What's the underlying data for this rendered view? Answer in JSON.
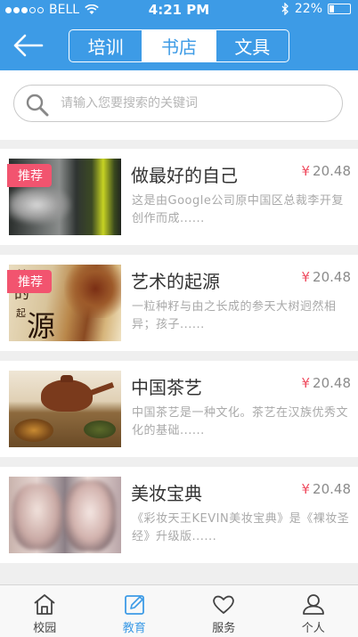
{
  "status": {
    "carrier": "BELL",
    "time": "4:21 PM",
    "battery": "22%",
    "battery_level": 0.22
  },
  "header": {
    "tabs": [
      "培训",
      "书店",
      "文具"
    ],
    "active_tab": 1
  },
  "search": {
    "placeholder": "请输入您要搜索的关键词"
  },
  "books": [
    {
      "title": "做最好的自己",
      "price": "20.48",
      "currency": "¥",
      "badge": "推荐",
      "desc": "这是由Google公司原中国区总裁李开复创作而成......"
    },
    {
      "title": "艺术的起源",
      "price": "20.48",
      "currency": "¥",
      "badge": "推荐",
      "desc": "一粒种籽与由之长成的参天大树迥然相异；孩子......"
    },
    {
      "title": "中国茶艺",
      "price": "20.48",
      "currency": "¥",
      "badge": "",
      "desc": "中国茶艺是一种文化。茶艺在汉族优秀文化的基础......"
    },
    {
      "title": "美妆宝典",
      "price": "20.48",
      "currency": "¥",
      "badge": "",
      "desc": "《彩妆天王KEVIN美妆宝典》是《裸妆圣经》升级版......"
    }
  ],
  "tabbar": [
    "校园",
    "教育",
    "服务",
    "个人"
  ],
  "tabbar_active": 1,
  "colors": {
    "primary": "#3d9be6",
    "badge": "#f2546f",
    "price_symbol": "#ef4f62"
  }
}
